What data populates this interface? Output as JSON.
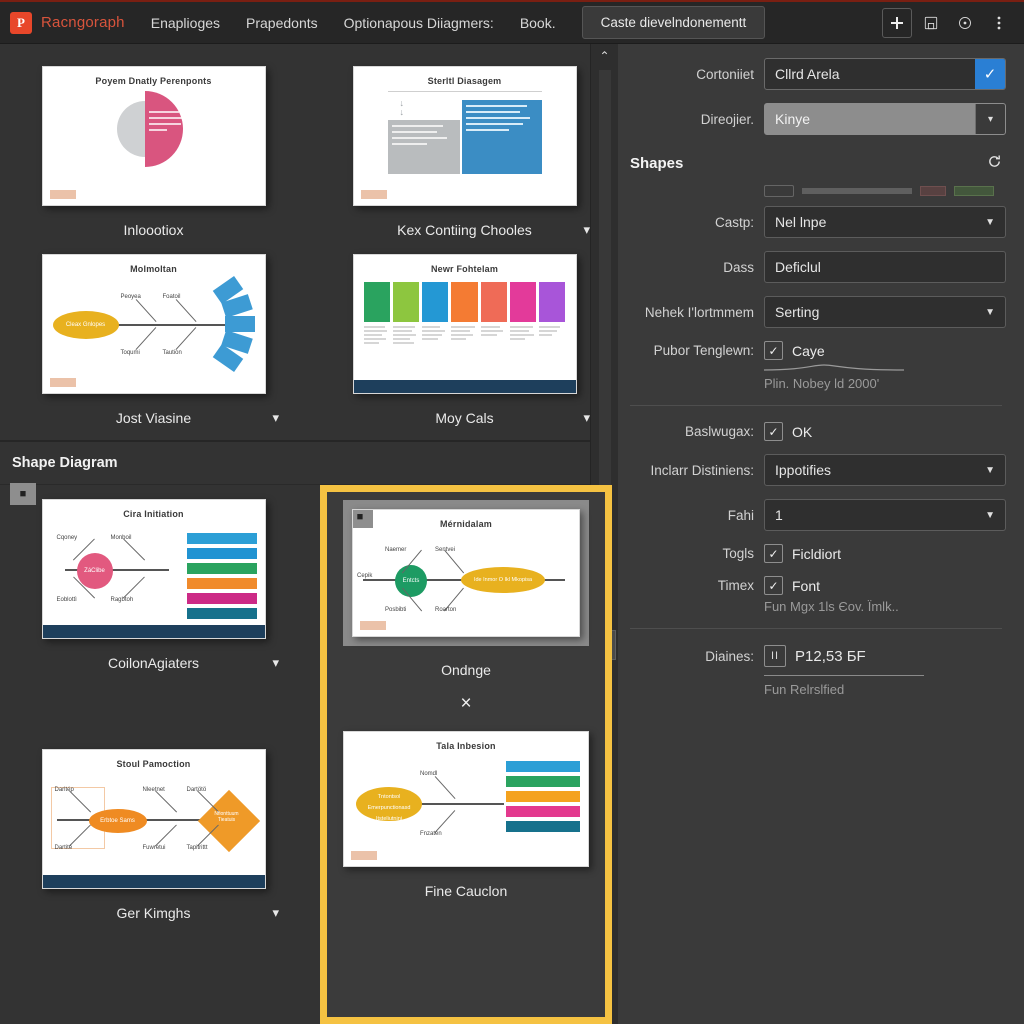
{
  "app": {
    "brand_initial": "P",
    "brand_name": "Racngoraph",
    "menu": [
      "Enaplioges",
      "Prapedonts",
      "Optionapous Diiagmers:",
      "Book."
    ],
    "cta_label": "Caste dievelndonementt",
    "icons": {
      "add": "add-icon",
      "save": "save-icon",
      "help": "help-icon",
      "more": "more-icon"
    }
  },
  "gallery": {
    "section_header": "Shape Diagram",
    "close_label": "×",
    "next_label": "▶",
    "top_items": [
      {
        "caption": "Inloootiox",
        "slide_title": "Poyem Dnatly Perenponts",
        "kind": "pie",
        "has_chevron": false
      },
      {
        "caption": "Keх Contiing Chooles",
        "slide_title": "Sterltl Diasagem",
        "kind": "stand",
        "has_chevron": true
      },
      {
        "caption": "Jost Viasine",
        "slide_title": "Molmoltan",
        "kind": "fishbone",
        "has_chevron": true
      },
      {
        "caption": "Moy Cals",
        "slide_title": "Newr Fohtelam",
        "kind": "colors",
        "has_chevron": true
      }
    ],
    "bottom_items": [
      {
        "caption": "CoilonAgiaters",
        "slide_title": "Cira Initiation",
        "kind": "bars-pink",
        "has_chevron": true
      },
      {
        "caption": "Ger Kimghs",
        "slide_title": "Stoul Pamoction",
        "kind": "diamond",
        "has_chevron": true
      }
    ],
    "selected_items": [
      {
        "caption": "Ondnge",
        "slide_title": "Mérnidalam",
        "kind": "mindmap"
      },
      {
        "caption": "Fine Cauclon",
        "slide_title": "Tala Inbesion",
        "kind": "bars-orange"
      }
    ],
    "fishbone_labels": [
      "Peoyea",
      "Foatoil",
      "Toqumi",
      "Taution"
    ],
    "fishbone_center": "Cleax Gnlopes",
    "mind_labels": [
      "Naemer",
      "Sentvei",
      "Posbibti",
      "Roarton"
    ],
    "mind_center": "Entcts",
    "mind_left": "Cepik",
    "mind_right": "Ide Inmor O Ikl Mkopisa",
    "diamond_labels": [
      "Darltép",
      "Dartité",
      "Nleetnet",
      "Fuwretui",
      "Dartötö",
      "Tapitrittt"
    ],
    "diamond_center": "Erbtoe Sams",
    "diamond_right": "Nfionttuum Tieatuis",
    "pink_center": "ZáClibe",
    "pink_labels": [
      "Cqoney",
      "Monboil",
      "Eoblottì",
      "Ragbtoh"
    ],
    "orange_center": "Tntontsol Emerpunctionasd Itsteliutninj",
    "orange_labels": [
      "Nomdl",
      "Fnzaten"
    ],
    "colors_swatches": [
      "#2aa35f",
      "#8dc63f",
      "#2498d4",
      "#f47b33",
      "#ef6b57",
      "#e33a9a",
      "#a855d9"
    ],
    "bars_pink": [
      "#2c9fd6",
      "#2193d2",
      "#2aa35f",
      "#f08a2b",
      "#cc2a86",
      "#16718c"
    ],
    "bars_orange": [
      "#2c9fd6",
      "#2aa35f",
      "#f4a21f",
      "#e3398e",
      "#16718c"
    ],
    "scroll": {
      "up": "⌃",
      "double_down": "⌄⌄",
      "down": "⌄"
    }
  },
  "panel": {
    "rows": [
      {
        "id": "container",
        "label": "Cortoniiet",
        "value": "Cllrd Arela",
        "type": "text-check",
        "checked": true
      },
      {
        "id": "direction",
        "label": "Direojier.",
        "value": "Kinye",
        "type": "select-grey"
      }
    ],
    "section": {
      "title": "Shapes",
      "refresh_icon": "refresh-icon"
    },
    "ghost_row": {
      "label": "",
      "visible": true
    },
    "rows2": [
      {
        "id": "caste",
        "label": "Castр:",
        "value": "Nel lnpe",
        "type": "select"
      },
      {
        "id": "dass",
        "label": "Dass",
        "value": "Deficlul",
        "type": "text"
      },
      {
        "id": "nehek",
        "label": "Nehek I'lortmmem",
        "value": "Serting",
        "type": "select"
      },
      {
        "id": "pubor",
        "label": "Pubor Tenglewn:",
        "value": "Caye",
        "type": "checkbox",
        "checked": true
      }
    ],
    "hint1": "Plin. Nobey ld 2000'",
    "rows3": [
      {
        "id": "baskwug",
        "label": "Baslwugах:",
        "value": "OK",
        "type": "checkbox",
        "checked": true
      },
      {
        "id": "inclarr",
        "label": "Inclarr Distiniens:",
        "value": "Ippotifies",
        "type": "select"
      },
      {
        "id": "fahi",
        "label": "Fahi",
        "value": "1",
        "type": "select"
      },
      {
        "id": "togls",
        "label": "Togls",
        "value": "Ficldiort",
        "type": "checkbox",
        "checked": true
      },
      {
        "id": "timex",
        "label": "Timex",
        "value": "Font",
        "type": "checkbox",
        "checked": true
      }
    ],
    "hint2": "Fun Mgх 1ls Єov. Їmlk..",
    "diaines": {
      "label": "Diaines:",
      "pill": "II",
      "value": "Р12,53 БF",
      "sub": "Fun Relrslfied"
    }
  }
}
